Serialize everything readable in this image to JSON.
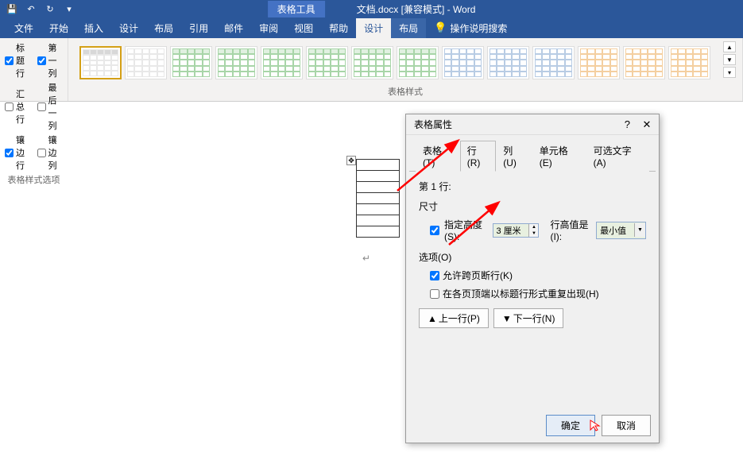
{
  "titlebar": {
    "context_tool_label": "表格工具",
    "doc_title": "文档.docx [兼容模式] - Word"
  },
  "ribbon_tabs": {
    "file": "文件",
    "home": "开始",
    "insert": "插入",
    "design": "设计",
    "layout": "布局",
    "references": "引用",
    "mailings": "邮件",
    "review": "审阅",
    "view": "视图",
    "help": "帮助",
    "tbl_design": "设计",
    "tbl_layout": "布局",
    "tell_me": "操作说明搜索"
  },
  "ribbon": {
    "options": {
      "header_row": "标题行",
      "first_col": "第一列",
      "total_row": "汇总行",
      "last_col": "最后一列",
      "banded_rows": "镶边行",
      "banded_cols": "镶边列",
      "group_label": "表格样式选项"
    },
    "styles": {
      "group_label": "表格样式"
    }
  },
  "dialog": {
    "title": "表格属性",
    "tabs": {
      "table": "表格(T)",
      "row": "行(R)",
      "column": "列(U)",
      "cell": "单元格(E)",
      "alt": "可选文字(A)"
    },
    "row_section": {
      "row_label": "第 1 行:",
      "size_label": "尺寸",
      "specify_height": "指定高度(S):",
      "height_value": "3 厘米",
      "row_height_is": "行高值是(I):",
      "row_height_type": "最小值",
      "options_label": "选项(O)",
      "allow_break": "允许跨页断行(K)",
      "repeat_header": "在各页顶端以标题行形式重复出现(H)",
      "prev_row": "上一行(P)",
      "next_row": "下一行(N)"
    },
    "buttons": {
      "ok": "确定",
      "cancel": "取消"
    }
  }
}
